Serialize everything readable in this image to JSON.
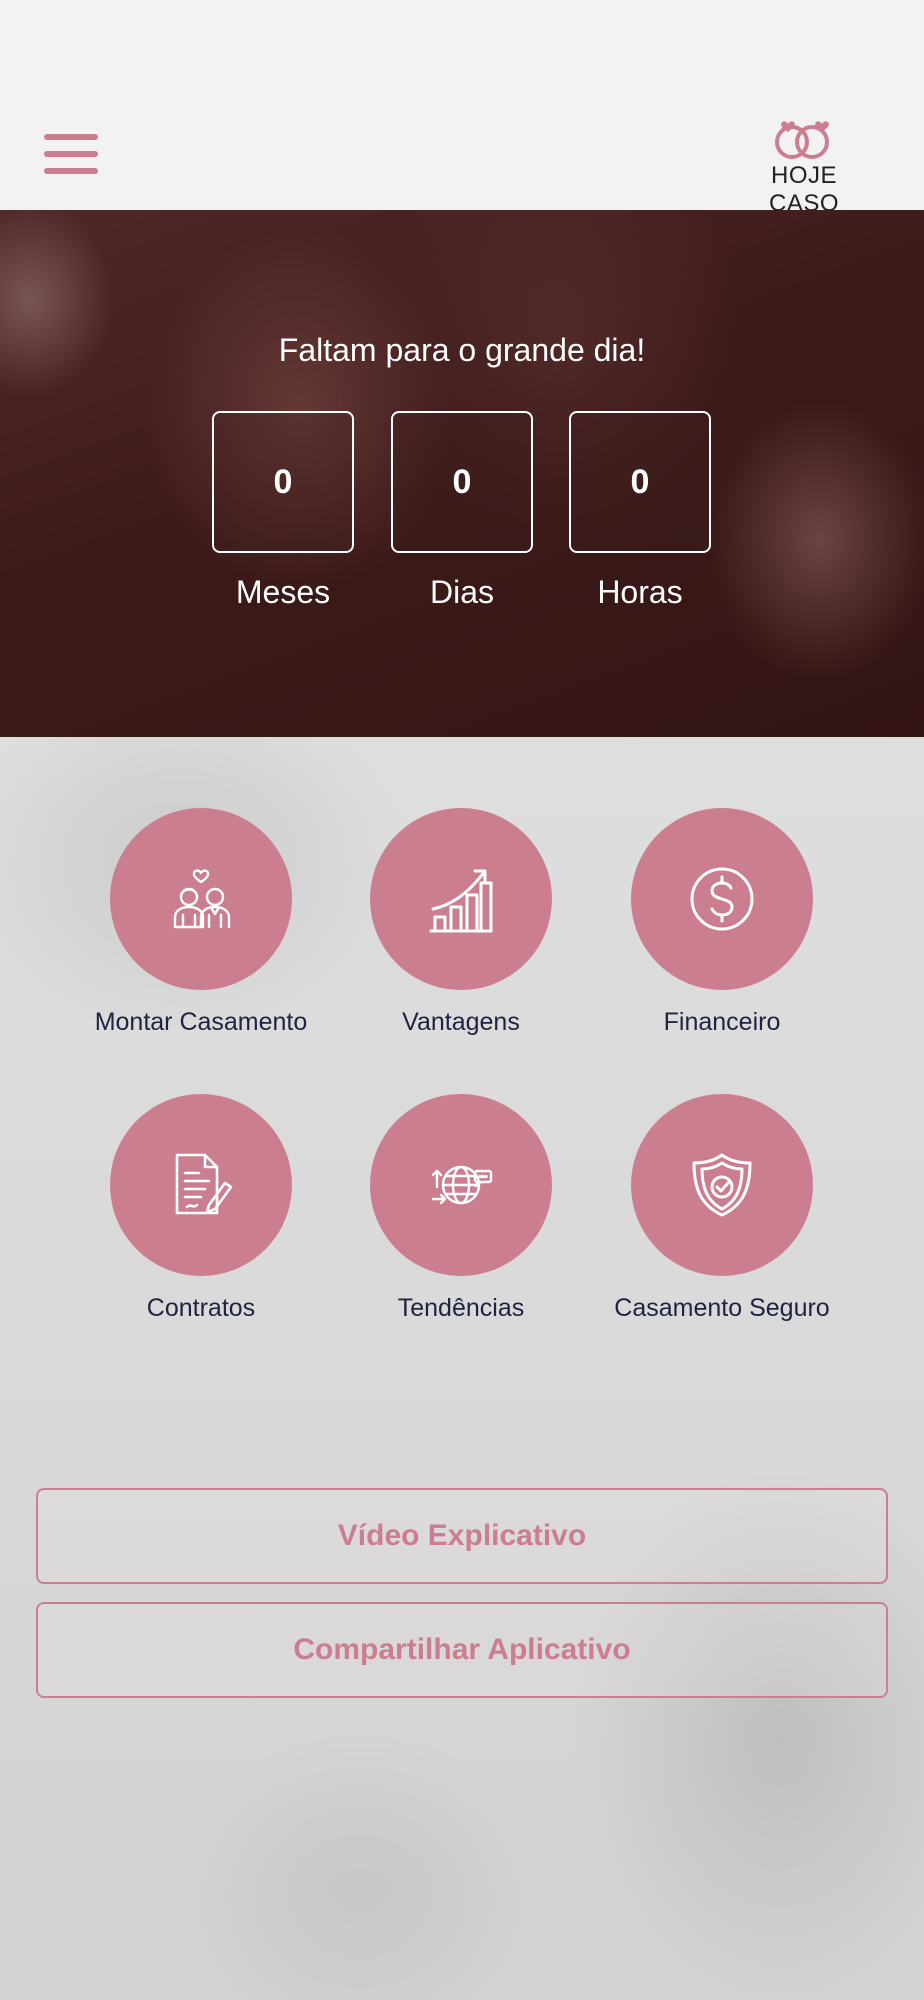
{
  "header": {
    "logo_text": "HOJE CASO",
    "menu_icon": "hamburger-menu-icon"
  },
  "hero": {
    "title": "Faltam para o grande dia!",
    "countdown": [
      {
        "value": "0",
        "label": "Meses"
      },
      {
        "value": "0",
        "label": "Dias"
      },
      {
        "value": "0",
        "label": "Horas"
      }
    ]
  },
  "features": [
    {
      "label": "Montar Casamento",
      "icon": "wedding-couple-icon"
    },
    {
      "label": "Vantagens",
      "icon": "growth-chart-icon"
    },
    {
      "label": "Financeiro",
      "icon": "dollar-coin-icon"
    },
    {
      "label": "Contratos",
      "icon": "contract-document-icon"
    },
    {
      "label": "Tendências",
      "icon": "globe-trends-icon"
    },
    {
      "label": "Casamento Seguro",
      "icon": "shield-check-icon"
    }
  ],
  "buttons": {
    "video": "Vídeo Explicativo",
    "share": "Compartilhar Aplicativo"
  },
  "colors": {
    "accent": "#cb7e90",
    "text_dark": "#1f2340",
    "header_bg": "#f2f2f2"
  }
}
